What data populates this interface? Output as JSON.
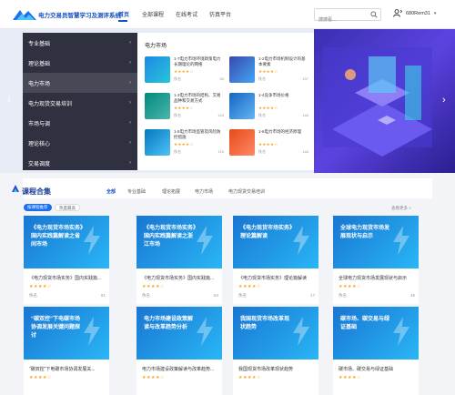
{
  "header": {
    "brand": "电力交易员智慧学习及测评系统",
    "nav": [
      "首页",
      "全部课程",
      "在线考试",
      "仿真平台"
    ],
    "search_placeholder": "搜搜看...",
    "username": "680Rem31"
  },
  "category_menu": [
    {
      "label": "专业基础"
    },
    {
      "label": "理论基础"
    },
    {
      "label": "电力市场"
    },
    {
      "label": "电力现货交易培训"
    },
    {
      "label": "市场与调"
    },
    {
      "label": "理论核心"
    },
    {
      "label": "交易调度"
    }
  ],
  "panel": {
    "title": "电力市场",
    "courses": [
      {
        "title": "1-7电力市场环境政策电力长期理论的网络",
        "stars": "★★★★☆",
        "author": "佚名",
        "count": "55"
      },
      {
        "title": "1-2电力市场机制设计的基本要素",
        "stars": "★★★★☆",
        "author": "佚名",
        "count": "137"
      },
      {
        "title": "1-3电力市场的结构、交易品种和交易方式",
        "stars": "★★★★☆",
        "author": "佚名",
        "count": "144"
      },
      {
        "title": "1-4竞争市场价格",
        "stars": "★★★★☆",
        "author": "佚名",
        "count": "146"
      },
      {
        "title": "1-5电力市场监管及风险防控措施",
        "stars": "★★★★☆",
        "author": "佚名",
        "count": "119"
      },
      {
        "title": "1-6电力市场的经济原理",
        "stars": "★★★★☆",
        "author": "佚名",
        "count": "146"
      }
    ]
  },
  "collection": {
    "title": "课程合集",
    "tabs": [
      "全部",
      "专业基础",
      "理论拓展",
      "电力市场",
      "电力现货交易培训"
    ],
    "more": "查看更多 >",
    "chips": [
      "按课程推荐",
      "热度最高"
    ]
  },
  "cards": [
    {
      "banner": "《电力现货市场实务》国内实践篇解读之省间市场",
      "name": "《电力现货市场实务》国内实践篇...",
      "stars": "★★★★☆",
      "author": "佚名",
      "count": "81"
    },
    {
      "banner": "《电力现货市场实务》国内实践篇解读之浙江市场",
      "name": "《电力现货市场实务》国内实践篇...",
      "stars": "★★★★☆",
      "author": "佚名",
      "count": "54"
    },
    {
      "banner": "《电力现货市场实务》理论篇解读",
      "name": "《电力现货市场实务》理论篇解读",
      "stars": "★★★★☆",
      "author": "佚名",
      "count": "17"
    },
    {
      "banner": "全球电力现货市场发展现状与启示",
      "name": "全球电力现货市场发展现状与启示",
      "stars": "★★★★☆",
      "author": "佚名",
      "count": "46"
    },
    {
      "banner": "“碳双控”下电碳市场协调发展关键问题探讨",
      "name": "“碳双控”下电碳市场协调发展关...",
      "stars": "★★★★☆",
      "author": "",
      "count": ""
    },
    {
      "banner": "电力市场建设政策解读与改革趋势分析",
      "name": "电力市场建设政策解读与改革趋势...",
      "stars": "★★★★☆",
      "author": "",
      "count": ""
    },
    {
      "banner": "我国现货市场改革现状趋势",
      "name": "我国现货市场改革现状趋势",
      "stars": "★★★★☆",
      "author": "",
      "count": ""
    },
    {
      "banner": "碳市场、碳交易与绿证基础",
      "name": "碳市场、碳交易与绿证基础",
      "stars": "★★★★☆",
      "author": "",
      "count": ""
    }
  ],
  "colors": {
    "accent": "#1a4fc0",
    "star": "#f5a623",
    "menu_bg": "#1e2030"
  }
}
